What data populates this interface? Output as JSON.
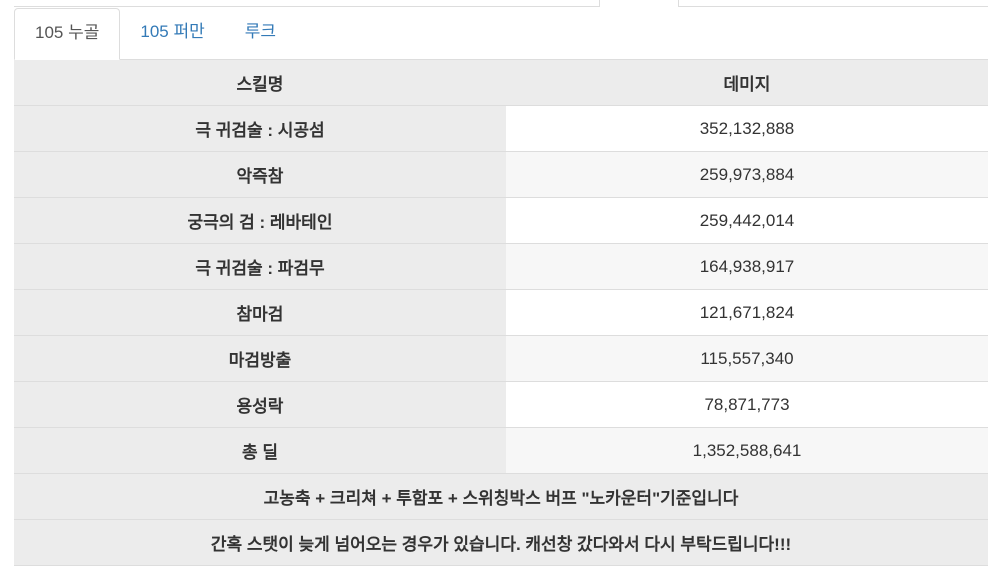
{
  "tabs": [
    {
      "label": "105 누골"
    },
    {
      "label": "105 퍼만"
    },
    {
      "label": "루크"
    }
  ],
  "table": {
    "headers": {
      "skill": "스킬명",
      "damage": "데미지"
    },
    "rows": [
      {
        "skill": "극 귀검술 : 시공섬",
        "damage": "352,132,888"
      },
      {
        "skill": "악즉참",
        "damage": "259,973,884"
      },
      {
        "skill": "궁극의 검 : 레바테인",
        "damage": "259,442,014"
      },
      {
        "skill": "극 귀검술 : 파검무",
        "damage": "164,938,917"
      },
      {
        "skill": "참마검",
        "damage": "121,671,824"
      },
      {
        "skill": "마검방출",
        "damage": "115,557,340"
      },
      {
        "skill": "용성락",
        "damage": "78,871,773"
      },
      {
        "skill": "총 딜",
        "damage": "1,352,588,641"
      }
    ],
    "notes": [
      "고농축 + 크리쳐 + 투함포 + 스위칭박스 버프 \"노카운터\"기준입니다",
      "간혹 스탯이 늦게 넘어오는 경우가 있습니다. 캐선창 갔다와서 다시 부탁드립니다!!!"
    ]
  },
  "colors": {
    "tab_link": "#337ab7",
    "tab_active": "#555555",
    "header_bg": "#ececec",
    "border": "#dddddd"
  }
}
